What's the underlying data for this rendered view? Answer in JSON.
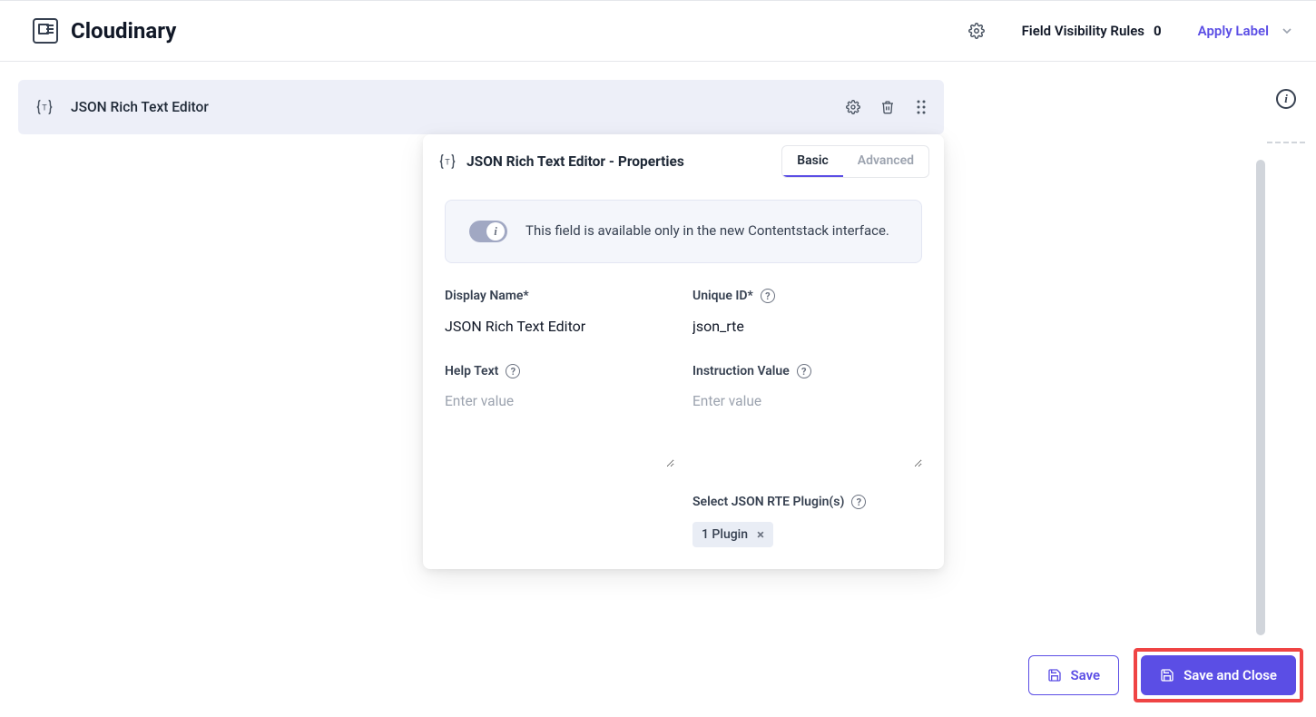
{
  "header": {
    "title": "Cloudinary",
    "field_visibility_label": "Field Visibility Rules",
    "field_visibility_count": "0",
    "apply_label": "Apply Label"
  },
  "field_bar": {
    "title": "JSON Rich Text Editor"
  },
  "panel": {
    "title": "JSON Rich Text Editor - Properties",
    "tabs": {
      "basic": "Basic",
      "advanced": "Advanced"
    },
    "info": "This field is available only in the new Contentstack interface.",
    "fields": {
      "display_name_label": "Display Name*",
      "display_name_value": "JSON Rich Text Editor",
      "unique_id_label": "Unique ID*",
      "unique_id_value": "json_rte",
      "help_text_label": "Help Text",
      "help_text_placeholder": "Enter value",
      "instruction_label": "Instruction Value",
      "instruction_placeholder": "Enter value",
      "plugins_label": "Select JSON RTE Plugin(s)",
      "plugins_chip": "1 Plugin"
    }
  },
  "footer": {
    "save": "Save",
    "save_close": "Save and Close"
  }
}
